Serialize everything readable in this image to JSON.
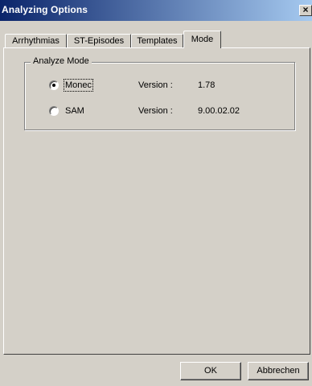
{
  "window": {
    "title": "Analyzing Options",
    "close_glyph": "×"
  },
  "tabs": [
    {
      "label": "Arrhythmias",
      "active": false
    },
    {
      "label": "ST-Episodes",
      "active": false
    },
    {
      "label": "Templates",
      "active": false
    },
    {
      "label": "Mode",
      "active": true
    }
  ],
  "analyze_mode": {
    "group_label": "Analyze Mode",
    "options": [
      {
        "label": "Monec",
        "selected": true,
        "version_label": "Version :",
        "version": "1.78"
      },
      {
        "label": "SAM",
        "selected": false,
        "version_label": "Version :",
        "version": "9.00.02.02"
      }
    ]
  },
  "buttons": {
    "ok": "OK",
    "cancel": "Abbrechen"
  }
}
